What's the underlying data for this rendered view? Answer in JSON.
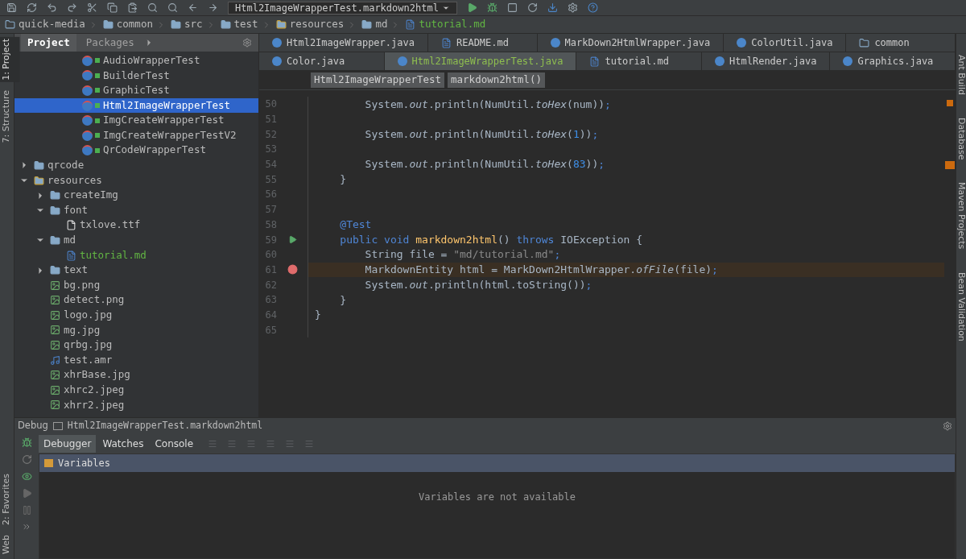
{
  "toolbar": {
    "run_config": "Html2ImageWrapperTest.markdown2html"
  },
  "nav_bar": [
    {
      "label": "quick-media",
      "kind": "module",
      "added": false
    },
    {
      "label": "common",
      "kind": "folder",
      "added": false
    },
    {
      "label": "src",
      "kind": "folder",
      "added": false
    },
    {
      "label": "test",
      "kind": "folder",
      "added": false
    },
    {
      "label": "resources",
      "kind": "resources",
      "added": false
    },
    {
      "label": "md",
      "kind": "folder",
      "added": false
    },
    {
      "label": "tutorial.md",
      "kind": "md",
      "added": true
    }
  ],
  "left_strip": [
    {
      "label": "1: Project",
      "selected": true
    },
    {
      "label": "7: Structure",
      "selected": false
    }
  ],
  "project_panel": {
    "tabs": [
      {
        "label": "Project",
        "selected": true
      },
      {
        "label": "Packages",
        "selected": false
      }
    ],
    "scrolled_children": [
      {
        "label": "AudioWrapperTest",
        "kind": "test",
        "selected": false,
        "added": false
      },
      {
        "label": "BuilderTest",
        "kind": "test",
        "selected": false,
        "added": false
      },
      {
        "label": "GraphicTest",
        "kind": "test",
        "selected": false,
        "added": false
      },
      {
        "label": "Html2ImageWrapperTest",
        "kind": "test",
        "selected": true,
        "added": false
      },
      {
        "label": "ImgCreateWrapperTest",
        "kind": "test",
        "selected": false,
        "added": false
      },
      {
        "label": "ImgCreateWrapperTestV2",
        "kind": "test",
        "selected": false,
        "added": false
      },
      {
        "label": "QrCodeWrapperTest",
        "kind": "test",
        "selected": false,
        "added": false
      }
    ],
    "tree": [
      {
        "label": "qrcode",
        "kind": "folder",
        "expanded": false,
        "selected": false,
        "added": false
      },
      {
        "label": "resources",
        "kind": "resources",
        "expanded": true,
        "selected": false,
        "added": false,
        "children": [
          {
            "label": "createImg",
            "kind": "folder",
            "expanded": false,
            "selected": false,
            "added": false
          },
          {
            "label": "font",
            "kind": "folder",
            "expanded": true,
            "selected": false,
            "added": false,
            "children": [
              {
                "label": "txlove.ttf",
                "kind": "file",
                "selected": false,
                "added": false
              }
            ]
          },
          {
            "label": "md",
            "kind": "folder",
            "expanded": true,
            "selected": false,
            "added": false,
            "children": [
              {
                "label": "tutorial.md",
                "kind": "md",
                "selected": false,
                "added": true
              }
            ]
          },
          {
            "label": "text",
            "kind": "folder",
            "expanded": false,
            "selected": false,
            "added": false
          },
          {
            "label": "bg.png",
            "kind": "image",
            "selected": false,
            "added": false
          },
          {
            "label": "detect.png",
            "kind": "image",
            "selected": false,
            "added": false
          },
          {
            "label": "logo.jpg",
            "kind": "image",
            "selected": false,
            "added": false
          },
          {
            "label": "mg.jpg",
            "kind": "image",
            "selected": false,
            "added": false
          },
          {
            "label": "qrbg.jpg",
            "kind": "image",
            "selected": false,
            "added": false
          },
          {
            "label": "test.amr",
            "kind": "audio",
            "selected": false,
            "added": false
          },
          {
            "label": "xhrBase.jpg",
            "kind": "image",
            "selected": false,
            "added": false
          },
          {
            "label": "xhrc2.jpeg",
            "kind": "image",
            "selected": false,
            "added": false
          },
          {
            "label": "xhrr2.jpeg",
            "kind": "image",
            "selected": false,
            "added": false
          }
        ]
      }
    ]
  },
  "editor_tabs": [
    [
      {
        "label": "Html2ImageWrapper.java",
        "kind": "java",
        "selected": false,
        "added": false
      },
      {
        "label": "README.md",
        "kind": "md",
        "selected": false,
        "added": false
      },
      {
        "label": "MarkDown2HtmlWrapper.java",
        "kind": "java",
        "selected": false,
        "added": false
      },
      {
        "label": "ColorUtil.java",
        "kind": "java",
        "selected": false,
        "added": false
      },
      {
        "label": "common",
        "kind": "module",
        "selected": false,
        "added": false
      }
    ],
    [
      {
        "label": "Color.java",
        "kind": "java",
        "selected": false,
        "added": false
      },
      {
        "label": "Html2ImageWrapperTest.java",
        "kind": "java",
        "selected": true,
        "added": true
      },
      {
        "label": "tutorial.md",
        "kind": "md",
        "selected": false,
        "added": false
      },
      {
        "label": "HtmlRender.java",
        "kind": "java",
        "selected": false,
        "added": false
      },
      {
        "label": "Graphics.java",
        "kind": "java",
        "selected": false,
        "added": false
      }
    ]
  ],
  "breadcrumb": [
    "Html2ImageWrapperTest",
    "markdown2html()"
  ],
  "code": [
    {
      "number": "50",
      "highlighted": false,
      "tokens": [
        {
          "text": "        System.",
          "kind": "plain"
        },
        {
          "text": "out",
          "kind": "italic"
        },
        {
          "text": ".println(NumUtil.",
          "kind": "plain"
        },
        {
          "text": "toHex",
          "kind": "italic"
        },
        {
          "text": "(num))",
          "kind": "plain"
        },
        {
          "text": ";",
          "kind": "punct"
        }
      ]
    },
    {
      "number": "51",
      "highlighted": false
    },
    {
      "number": "52",
      "highlighted": false,
      "tokens": [
        {
          "text": "        System.",
          "kind": "plain"
        },
        {
          "text": "out",
          "kind": "italic"
        },
        {
          "text": ".println(NumUtil.",
          "kind": "plain"
        },
        {
          "text": "toHex",
          "kind": "italic"
        },
        {
          "text": "(",
          "kind": "plain"
        },
        {
          "text": "1",
          "kind": "number"
        },
        {
          "text": "))",
          "kind": "plain"
        },
        {
          "text": ";",
          "kind": "punct"
        }
      ]
    },
    {
      "number": "53",
      "highlighted": false
    },
    {
      "number": "54",
      "highlighted": false,
      "tokens": [
        {
          "text": "        System.",
          "kind": "plain"
        },
        {
          "text": "out",
          "kind": "italic"
        },
        {
          "text": ".println(NumUtil.",
          "kind": "plain"
        },
        {
          "text": "toHex",
          "kind": "italic"
        },
        {
          "text": "(",
          "kind": "plain"
        },
        {
          "text": "83",
          "kind": "number"
        },
        {
          "text": "))",
          "kind": "plain"
        },
        {
          "text": ";",
          "kind": "punct"
        }
      ]
    },
    {
      "number": "55",
      "highlighted": false,
      "tokens": [
        {
          "text": "    }",
          "kind": "plain"
        }
      ]
    },
    {
      "number": "56",
      "highlighted": false
    },
    {
      "number": "57",
      "highlighted": false
    },
    {
      "number": "58",
      "highlighted": false,
      "tokens": [
        {
          "text": "    @Test",
          "kind": "keyword"
        }
      ]
    },
    {
      "number": "59",
      "gutter": {
        "kind": "run"
      },
      "highlighted": false,
      "tokens": [
        {
          "text": "    public void ",
          "kind": "keyword"
        },
        {
          "text": "markdown2html",
          "kind": "method"
        },
        {
          "text": "() ",
          "kind": "plain"
        },
        {
          "text": "throws ",
          "kind": "keyword"
        },
        {
          "text": "IOException {",
          "kind": "plain"
        }
      ]
    },
    {
      "number": "60",
      "highlighted": false,
      "tokens": [
        {
          "text": "        String file = ",
          "kind": "plain"
        },
        {
          "text": "\"md/tutorial.md\"",
          "kind": "string"
        },
        {
          "text": ";",
          "kind": "punct"
        }
      ]
    },
    {
      "number": "61",
      "gutter": {
        "kind": "breakpoint"
      },
      "highlighted": true,
      "tokens": [
        {
          "text": "        MarkdownEntity html = MarkDown2HtmlWrapper.",
          "kind": "plain"
        },
        {
          "text": "ofFile",
          "kind": "italic"
        },
        {
          "text": "(file)",
          "kind": "plain"
        },
        {
          "text": ";",
          "kind": "punct"
        }
      ]
    },
    {
      "number": "62",
      "highlighted": false,
      "tokens": [
        {
          "text": "        System.",
          "kind": "plain"
        },
        {
          "text": "out",
          "kind": "italic"
        },
        {
          "text": ".println(html.toString())",
          "kind": "plain"
        },
        {
          "text": ";",
          "kind": "punct"
        }
      ]
    },
    {
      "number": "63",
      "highlighted": false,
      "tokens": [
        {
          "text": "    }",
          "kind": "plain"
        }
      ]
    },
    {
      "number": "64",
      "highlighted": false,
      "tokens": [
        {
          "text": "}",
          "kind": "plain"
        }
      ]
    },
    {
      "number": "65",
      "highlighted": false
    }
  ],
  "right_strip": [
    "Ant Build",
    "Database",
    "Maven Projects",
    "Bean Validation"
  ],
  "debug": {
    "title": "Debug",
    "session": "Html2ImageWrapperTest.markdown2html",
    "tabs": [
      {
        "label": "Debugger",
        "selected": true
      },
      {
        "label": "Watches",
        "selected": false
      },
      {
        "label": "Console",
        "selected": false
      }
    ],
    "variables_header": "Variables",
    "empty_message": "Variables are not available"
  },
  "bottom_left_strip": [
    "2: Favorites",
    "Web"
  ]
}
